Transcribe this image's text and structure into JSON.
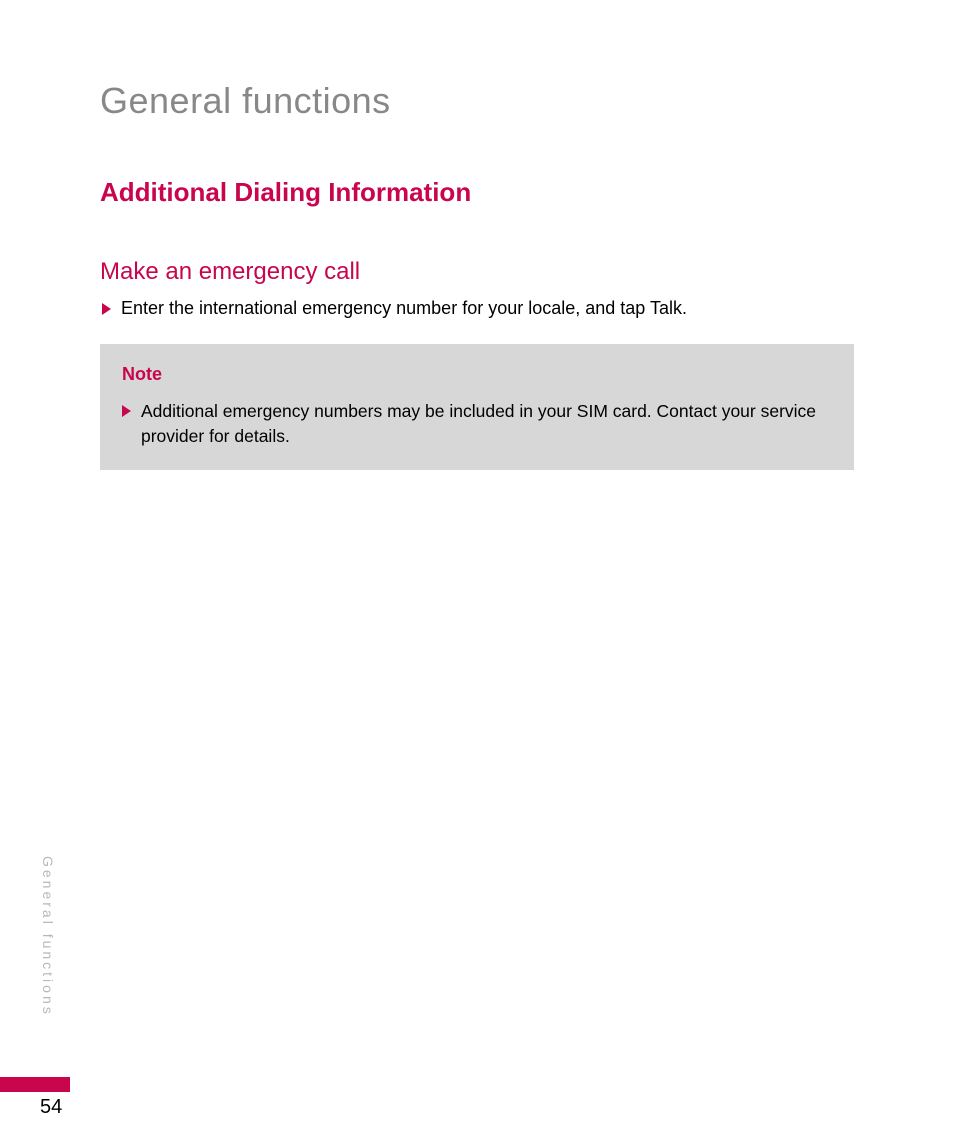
{
  "chapter_title": "General functions",
  "section_title": "Additional Dialing Information",
  "subsection_title": "Make an emergency call",
  "main_bullet": "Enter the international emergency number for your locale, and tap Talk.",
  "note": {
    "label": "Note",
    "bullet": "Additional emergency numbers may be included in your SIM card. Contact your service provider for details."
  },
  "side_label": "General functions",
  "page_number": "54"
}
